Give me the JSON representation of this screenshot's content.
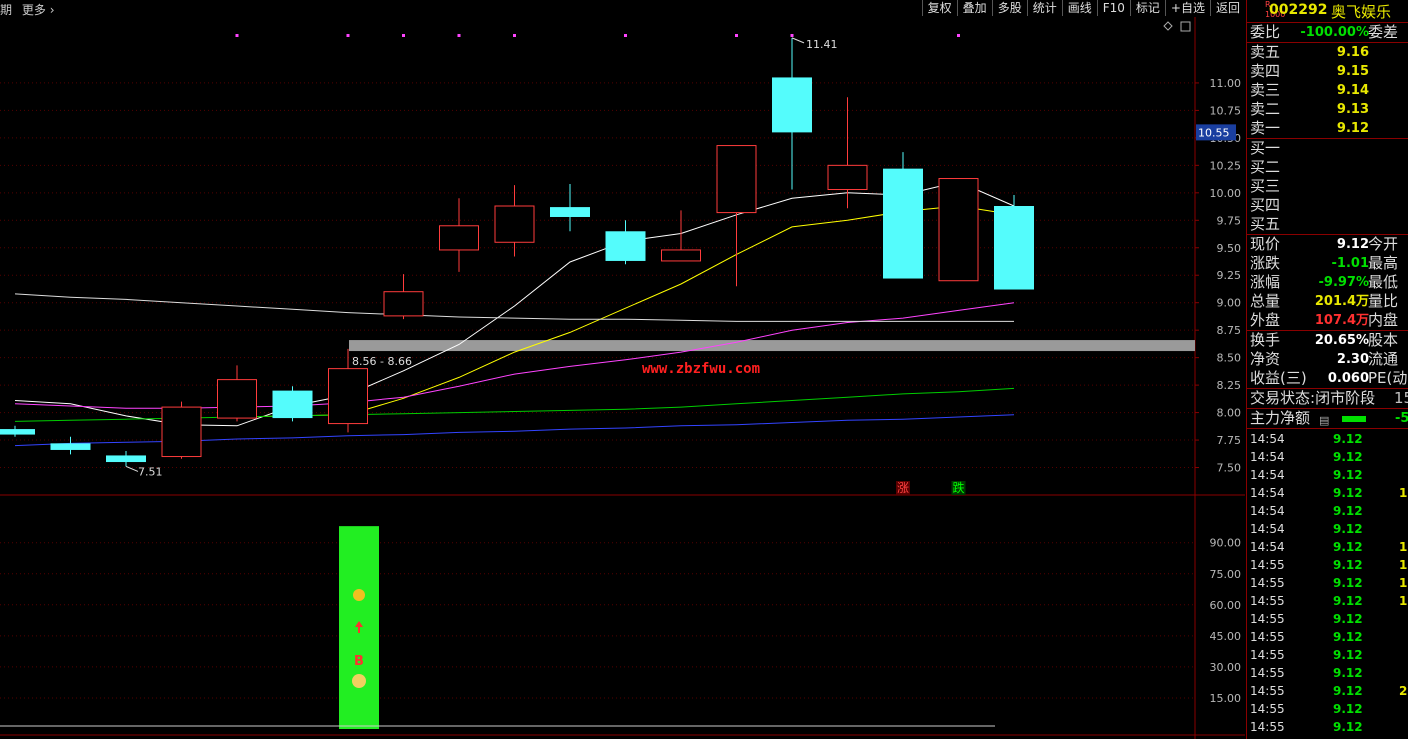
{
  "toolbar": {
    "left_text": "期",
    "more_label": "更多",
    "buttons": [
      "复权",
      "叠加",
      "多股",
      "统计",
      "画线",
      "F10",
      "标记",
      "+自选",
      "返回"
    ]
  },
  "stock": {
    "code": "002292",
    "name": "奥飞娱乐",
    "badge_top": "R",
    "badge_bottom": "1000"
  },
  "order_book": {
    "ratio_label": "委比",
    "ratio_value": "-100.00%",
    "diff_label": "委差",
    "asks": [
      {
        "label": "卖五",
        "price": "9.16"
      },
      {
        "label": "卖四",
        "price": "9.15"
      },
      {
        "label": "卖三",
        "price": "9.14"
      },
      {
        "label": "卖二",
        "price": "9.13"
      },
      {
        "label": "卖一",
        "price": "9.12"
      }
    ],
    "bids": [
      {
        "label": "买一",
        "price": ""
      },
      {
        "label": "买二",
        "price": ""
      },
      {
        "label": "买三",
        "price": ""
      },
      {
        "label": "买四",
        "price": ""
      },
      {
        "label": "买五",
        "price": ""
      }
    ]
  },
  "quote": [
    {
      "label": "现价",
      "value": "9.12",
      "label2": "今开",
      "color": "wht"
    },
    {
      "label": "涨跌",
      "value": "-1.01",
      "label2": "最高",
      "color": "down"
    },
    {
      "label": "涨幅",
      "value": "-9.97%",
      "label2": "最低",
      "color": "down"
    },
    {
      "label": "总量",
      "value": "201.4万",
      "label2": "量比",
      "color": "yel"
    },
    {
      "label": "外盘",
      "value": "107.4万",
      "label2": "内盘",
      "color": "up"
    }
  ],
  "fundamentals": [
    {
      "label": "换手",
      "value": "20.65%",
      "label2": "股本"
    },
    {
      "label": "净资",
      "value": "2.30",
      "label2": "流通"
    },
    {
      "label": "收益(三)",
      "value": "0.060",
      "label2": "PE(动)"
    }
  ],
  "status": {
    "trade_label": "交易状态:",
    "trade_value": "闭市阶段",
    "trade_time": "15:",
    "flow_label": "主力净额",
    "flow_value": "-5."
  },
  "ticks": [
    {
      "time": "14:54",
      "price": "9.12",
      "vol": ""
    },
    {
      "time": "14:54",
      "price": "9.12",
      "vol": ""
    },
    {
      "time": "14:54",
      "price": "9.12",
      "vol": ""
    },
    {
      "time": "14:54",
      "price": "9.12",
      "vol": "1"
    },
    {
      "time": "14:54",
      "price": "9.12",
      "vol": ""
    },
    {
      "time": "14:54",
      "price": "9.12",
      "vol": ""
    },
    {
      "time": "14:54",
      "price": "9.12",
      "vol": "1"
    },
    {
      "time": "14:55",
      "price": "9.12",
      "vol": "1"
    },
    {
      "time": "14:55",
      "price": "9.12",
      "vol": "1"
    },
    {
      "time": "14:55",
      "price": "9.12",
      "vol": "1"
    },
    {
      "time": "14:55",
      "price": "9.12",
      "vol": ""
    },
    {
      "time": "14:55",
      "price": "9.12",
      "vol": ""
    },
    {
      "time": "14:55",
      "price": "9.12",
      "vol": ""
    },
    {
      "time": "14:55",
      "price": "9.12",
      "vol": ""
    },
    {
      "time": "14:55",
      "price": "9.12",
      "vol": "2"
    },
    {
      "time": "14:55",
      "price": "9.12",
      "vol": ""
    },
    {
      "time": "14:55",
      "price": "9.12",
      "vol": ""
    }
  ],
  "chart_data": {
    "type": "candlestick",
    "price_axis": {
      "ticks": [
        7.5,
        7.75,
        8.0,
        8.25,
        8.5,
        8.75,
        9.0,
        9.25,
        9.5,
        9.75,
        10.0,
        10.25,
        10.5,
        10.75,
        11.0
      ],
      "ylim": [
        7.25,
        11.6
      ]
    },
    "current_price_marker": "10.55",
    "max_label": "11.41",
    "min_label": "7.51",
    "zone_label": "8.56 - 8.66",
    "zone": [
      8.56,
      8.66
    ],
    "watermark": "www.zbzfwu.com",
    "candles": [
      {
        "o": 7.85,
        "c": 7.8,
        "h": 7.88,
        "l": 7.78
      },
      {
        "o": 7.72,
        "c": 7.66,
        "h": 7.78,
        "l": 7.62
      },
      {
        "o": 7.61,
        "c": 7.55,
        "h": 7.65,
        "l": 7.51
      },
      {
        "o": 7.6,
        "c": 8.05,
        "h": 8.1,
        "l": 7.58
      },
      {
        "o": 7.95,
        "c": 8.3,
        "h": 8.43,
        "l": 7.92
      },
      {
        "o": 8.2,
        "c": 7.95,
        "h": 8.24,
        "l": 7.92
      },
      {
        "o": 7.9,
        "c": 8.4,
        "h": 8.58,
        "l": 7.82
      },
      {
        "o": 8.88,
        "c": 9.1,
        "h": 9.26,
        "l": 8.85
      },
      {
        "o": 9.48,
        "c": 9.7,
        "h": 9.95,
        "l": 9.28
      },
      {
        "o": 9.55,
        "c": 9.88,
        "h": 10.07,
        "l": 9.42
      },
      {
        "o": 9.87,
        "c": 9.78,
        "h": 10.08,
        "l": 9.65
      },
      {
        "o": 9.65,
        "c": 9.38,
        "h": 9.75,
        "l": 9.35
      },
      {
        "o": 9.38,
        "c": 9.48,
        "h": 9.84,
        "l": 9.38
      },
      {
        "o": 9.82,
        "c": 10.43,
        "h": 10.43,
        "l": 9.15
      },
      {
        "o": 11.05,
        "c": 10.55,
        "h": 11.41,
        "l": 10.03
      },
      {
        "o": 10.03,
        "c": 10.25,
        "h": 10.87,
        "l": 9.86
      },
      {
        "o": 10.22,
        "c": 9.22,
        "h": 10.37,
        "l": 9.22
      },
      {
        "o": 9.2,
        "c": 10.13,
        "h": 10.13,
        "l": 9.2
      },
      {
        "o": 9.88,
        "c": 9.12,
        "h": 9.98,
        "l": 9.12
      }
    ],
    "ma": [
      {
        "color": "#ffffff",
        "values": [
          8.11,
          8.08,
          7.97,
          7.89,
          7.88,
          8.06,
          8.16,
          8.38,
          8.62,
          8.97,
          9.37,
          9.56,
          9.63,
          9.8,
          9.95,
          10.0,
          9.98,
          10.1,
          9.88
        ]
      },
      {
        "color": "#ffff00",
        "values": [
          null,
          null,
          null,
          null,
          7.96,
          7.97,
          7.98,
          8.13,
          8.32,
          8.55,
          8.73,
          8.95,
          9.17,
          9.44,
          9.69,
          9.75,
          9.83,
          9.88,
          9.8
        ]
      },
      {
        "color": "#ff44ff",
        "values": [
          8.08,
          8.06,
          8.04,
          8.04,
          8.05,
          8.06,
          8.09,
          8.14,
          8.24,
          8.35,
          8.42,
          8.48,
          8.55,
          8.64,
          8.75,
          8.82,
          8.86,
          8.93,
          9.0
        ]
      },
      {
        "color": "#00cc00",
        "values": [
          7.92,
          7.93,
          7.94,
          7.95,
          7.96,
          7.97,
          7.98,
          7.99,
          8.0,
          8.01,
          8.02,
          8.03,
          8.05,
          8.08,
          8.11,
          8.14,
          8.17,
          8.19,
          8.22
        ]
      },
      {
        "color": "#3344ff",
        "values": [
          7.7,
          7.72,
          7.73,
          7.74,
          7.76,
          7.77,
          7.79,
          7.8,
          7.82,
          7.83,
          7.85,
          7.86,
          7.88,
          7.89,
          7.91,
          7.93,
          7.94,
          7.96,
          7.98
        ]
      },
      {
        "color": "#dddddd",
        "values": [
          9.08,
          9.05,
          9.03,
          9.0,
          8.97,
          8.94,
          8.91,
          8.89,
          8.87,
          8.86,
          8.85,
          8.85,
          8.84,
          8.83,
          8.83,
          8.83,
          8.83,
          8.83,
          8.83
        ]
      }
    ],
    "labels_bottom": [
      "涨",
      "跌"
    ],
    "indicator": {
      "ticks": [
        15.0,
        30.0,
        45.0,
        60.0,
        75.0,
        90.0
      ],
      "ylim": [
        0,
        100
      ],
      "bar_index": 6,
      "bar_value": 98,
      "bar_text": "B"
    }
  }
}
